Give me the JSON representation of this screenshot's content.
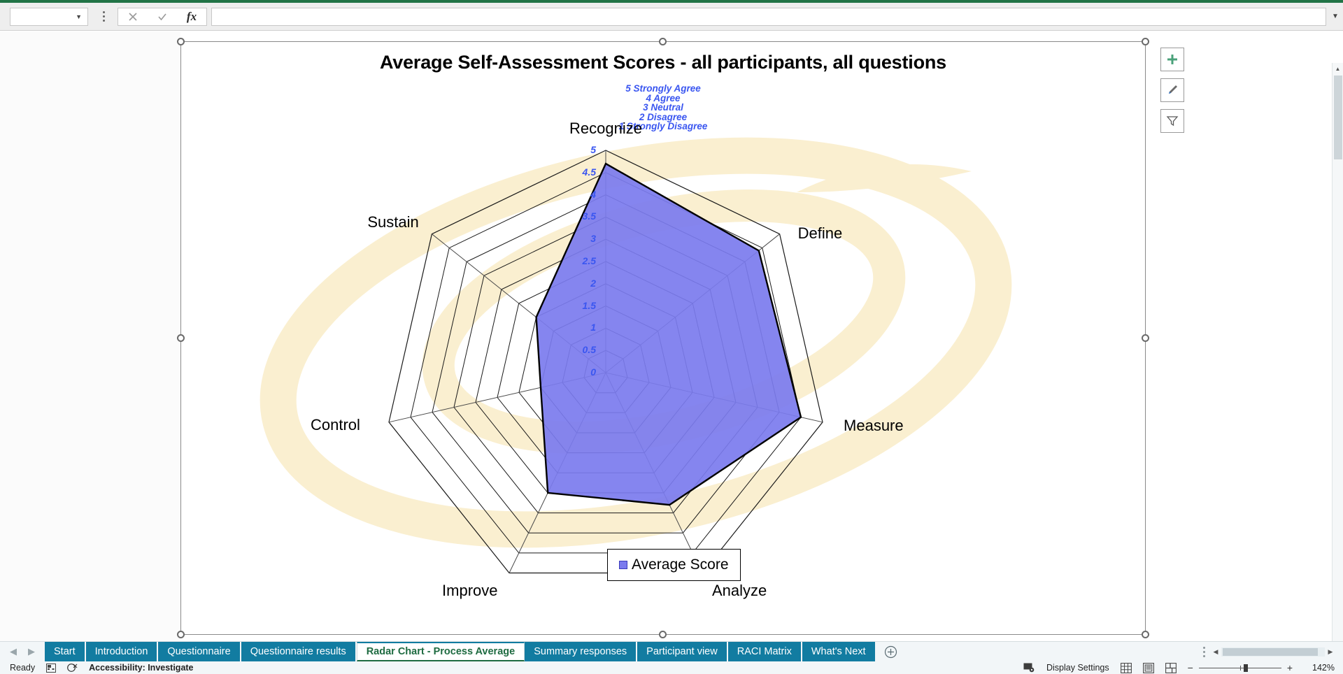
{
  "formula_bar": {
    "name_box_value": "",
    "name_box_icon": "chevron-down-icon",
    "cancel_icon": "close-icon",
    "confirm_icon": "check-icon",
    "function_icon": "fx-icon",
    "formula_value": "",
    "expand_icon": "chevron-down-icon"
  },
  "chart": {
    "title": "Average Self-Assessment Scores - all participants, all questions",
    "buttons": [
      {
        "name": "chart-elements-button",
        "icon": "plus-icon",
        "color": "#4aa17a"
      },
      {
        "name": "chart-styles-button",
        "icon": "paintbrush-icon",
        "color": "#3f6fb5"
      },
      {
        "name": "chart-filters-button",
        "icon": "funnel-icon",
        "color": "#666666"
      }
    ],
    "scale_note": [
      "5 Strongly Agree",
      "4 Agree",
      "3 Neutral",
      "2 Disagree",
      "1 Strongly Disagree"
    ],
    "scale_note_color": "#3a56f0",
    "legend": {
      "label": "Average Score",
      "swatch_color": "#7b7bee"
    }
  },
  "chart_data": {
    "type": "radar",
    "title": "Average Self-Assessment Scores - all participants, all questions",
    "categories": [
      "Recognize",
      "Define",
      "Measure",
      "Analyze",
      "Improve",
      "Control",
      "Sustain"
    ],
    "series": [
      {
        "name": "Average Score",
        "values": [
          4.7,
          4.4,
          4.5,
          3.3,
          3.0,
          1.5,
          2.0
        ],
        "fill": "#7b7bee",
        "line": "#000000"
      }
    ],
    "tick_labels": [
      "0",
      "0.5",
      "1",
      "1.5",
      "2",
      "2.5",
      "3",
      "3.5",
      "4",
      "4.5",
      "5"
    ],
    "tick_values": [
      0,
      0.5,
      1,
      1.5,
      2,
      2.5,
      3,
      3.5,
      4,
      4.5,
      5
    ],
    "rlim": [
      0,
      5
    ],
    "tick_color": "#3a56f0",
    "grid": true,
    "legend_position": "bottom",
    "annotations": [
      "5 Strongly Agree",
      "4 Agree",
      "3 Neutral",
      "2 Disagree",
      "1 Strongly Disagree"
    ]
  },
  "sheet_tabs": {
    "prev_icon": "chevron-left-icon",
    "next_icon": "chevron-right-icon",
    "add_icon": "plus-circle-icon",
    "items": [
      {
        "label": "Start",
        "active": false
      },
      {
        "label": "Introduction",
        "active": false
      },
      {
        "label": "Questionnaire",
        "active": false
      },
      {
        "label": "Questionnaire results",
        "active": false
      },
      {
        "label": "Radar Chart - Process Average",
        "active": true
      },
      {
        "label": "Summary responses",
        "active": false
      },
      {
        "label": "Participant view",
        "active": false
      },
      {
        "label": "RACI Matrix",
        "active": false
      },
      {
        "label": "What's Next",
        "active": false
      }
    ]
  },
  "status_bar": {
    "mode": "Ready",
    "record_macro_icon": "record-macro-icon",
    "accessibility_icon": "accessibility-icon",
    "accessibility": "Accessibility: Investigate",
    "display_settings_icon": "display-settings-icon",
    "display_settings": "Display Settings",
    "view_normal_icon": "normal-view-icon",
    "view_page_layout_icon": "page-layout-icon",
    "view_page_break_icon": "page-break-icon",
    "zoom_out_icon": "minus-icon",
    "zoom_in_icon": "plus-icon",
    "zoom_level": "142%"
  }
}
